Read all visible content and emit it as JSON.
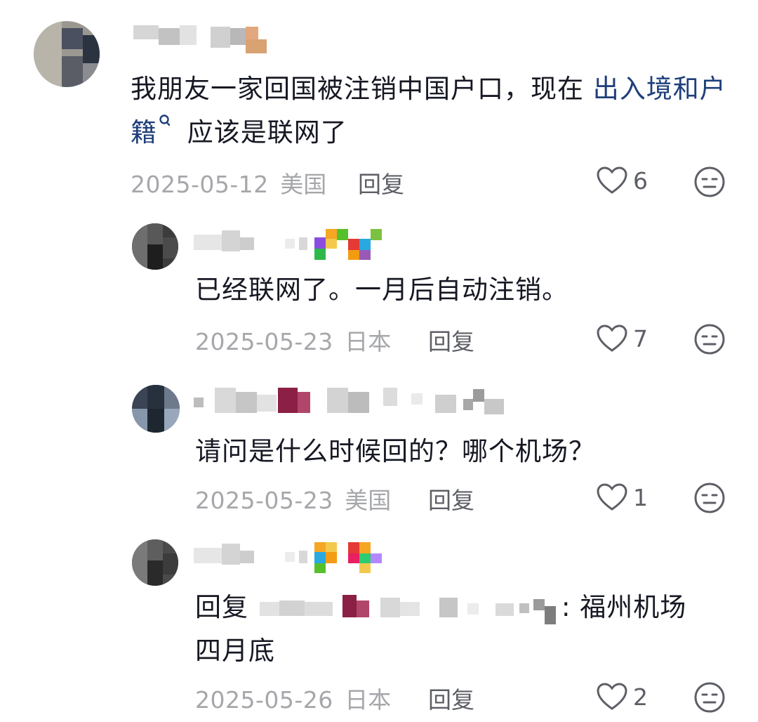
{
  "comments": [
    {
      "text_before_link": "我朋友一家回国被注销中国户口，现在 ",
      "link_text": "出入境和户籍",
      "text_after_link": " 应该是联网了",
      "date": "2025-05-12",
      "region": "美国",
      "reply_label": "回复",
      "likes": "6",
      "icons": [
        "heart-icon",
        "dislike-face-icon",
        "search-icon"
      ]
    },
    {
      "text": "已经联网了。一月后自动注销。",
      "date": "2025-05-23",
      "region": "日本",
      "reply_label": "回复",
      "likes": "7"
    },
    {
      "text": "请问是什么时候回的？哪个机场？",
      "date": "2025-05-23",
      "region": "美国",
      "reply_label": "回复",
      "likes": "1"
    },
    {
      "reply_prefix": "回复",
      "text_after_mention": ": 福州机场",
      "text_line2": "四月底",
      "date": "2025-05-26",
      "region": "日本",
      "reply_label": "回复",
      "likes": "2"
    }
  ],
  "colors": {
    "text": "#161823",
    "link": "#1f3f7a",
    "meta": "#a6a7ab",
    "action": "#5d5f66"
  }
}
